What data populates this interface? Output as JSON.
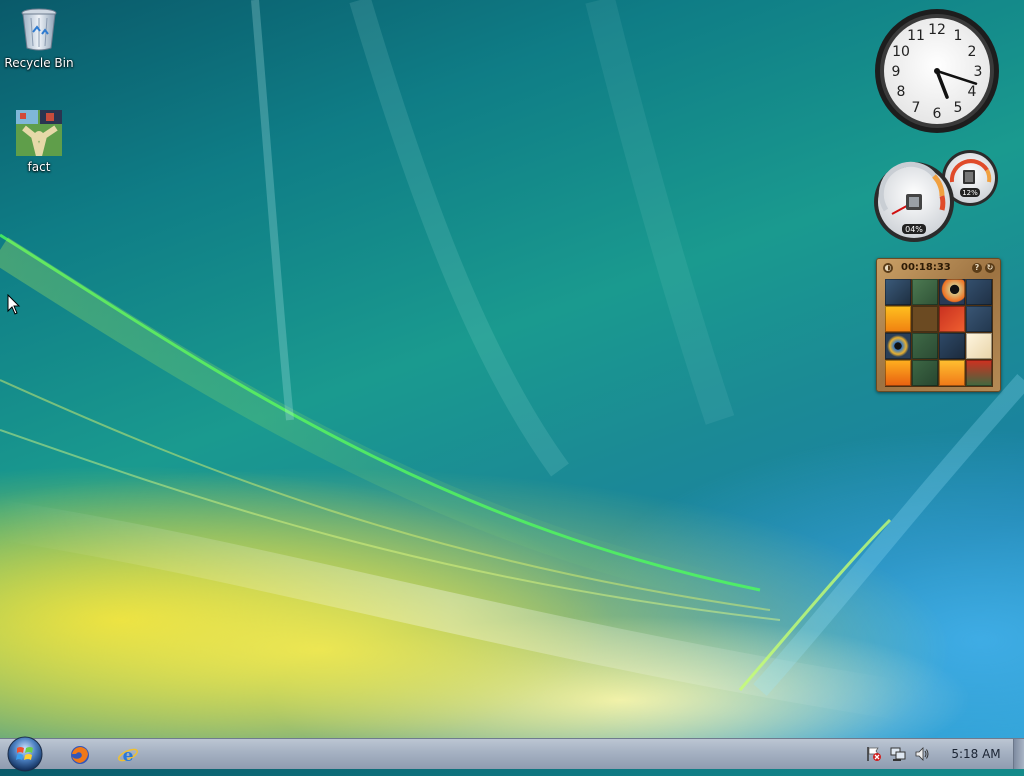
{
  "desktop": {
    "icons": [
      {
        "label": "Recycle Bin",
        "icon": "recycle-bin-icon"
      },
      {
        "label": "fact",
        "icon": "image-file-icon"
      }
    ]
  },
  "gadgets": {
    "clock": {
      "hours": 5,
      "minutes": 18
    },
    "cpu_meter": {
      "cpu_label": "04%",
      "memory_label": "12%"
    },
    "picture_puzzle": {
      "timer": "00:18:33",
      "help_label": "?",
      "restart_label": "↻"
    }
  },
  "taskbar": {
    "start_icon": "windows-logo-icon",
    "quick_launch": [
      {
        "name": "firefox",
        "icon": "firefox-icon"
      },
      {
        "name": "internet-explorer",
        "icon": "internet-explorer-icon"
      }
    ],
    "tray": [
      {
        "icon": "action-center-flag-icon"
      },
      {
        "icon": "network-icon"
      },
      {
        "icon": "volume-icon"
      }
    ],
    "time": "5:18 AM"
  },
  "colors": {
    "taskbar": "#a5b1c2",
    "wallpaper_top": "#0f7d86",
    "wallpaper_bottom_left": "#e6d23a"
  }
}
